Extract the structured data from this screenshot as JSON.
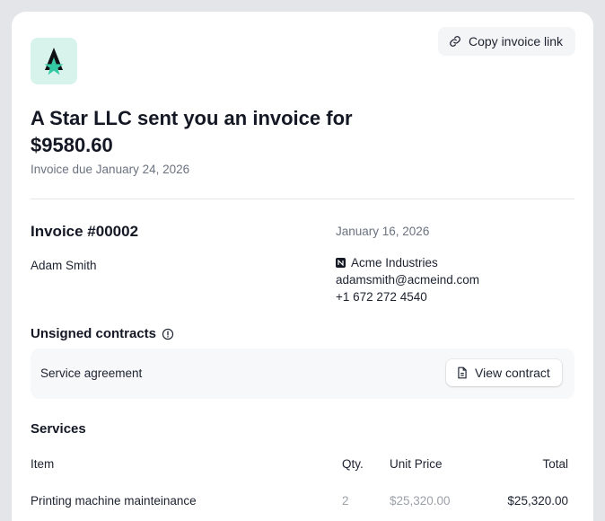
{
  "header": {
    "copy_link_label": "Copy invoice link",
    "copy_link_icon": "link-icon",
    "logo_icon": "a-star-logo",
    "brand_colors": {
      "logo_bg": "#d8f3ec",
      "star": "#33c9a3",
      "letter": "#0f1115"
    }
  },
  "summary": {
    "headline_line1": "A Star LLC sent you an invoice for",
    "headline_line2": "$9580.60",
    "due_text": "Invoice due January 24, 2026"
  },
  "invoice": {
    "number": "Invoice #00002",
    "date": "January 16, 2026",
    "bill_to_name": "Adam Smith",
    "company": "Acme Industries",
    "email": "adamsmith@acmeind.com",
    "phone": "+1 672 272 4540"
  },
  "contracts": {
    "title": "Unsigned contracts",
    "info_icon": "info-icon",
    "items": [
      {
        "name": "Service agreement",
        "action_label": "View contract",
        "action_icon": "document-icon"
      }
    ]
  },
  "services": {
    "title": "Services",
    "columns": [
      "Item",
      "Qty.",
      "Unit Price",
      "Total"
    ],
    "rows": [
      {
        "item": "Printing machine mainteinance",
        "qty": "2",
        "unit_price": "$25,320.00",
        "total": "$25,320.00"
      }
    ]
  }
}
